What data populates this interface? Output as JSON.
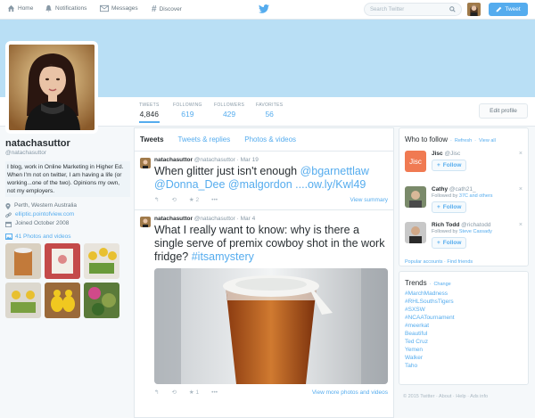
{
  "nav": {
    "home": "Home",
    "notifications": "Notifications",
    "messages": "Messages",
    "discover": "Discover",
    "search_placeholder": "Search Twitter",
    "tweet_button": "Tweet"
  },
  "stats": [
    {
      "label": "TWEETS",
      "value": "4,846"
    },
    {
      "label": "FOLLOWING",
      "value": "619"
    },
    {
      "label": "FOLLOWERS",
      "value": "429"
    },
    {
      "label": "FAVORITES",
      "value": "56"
    }
  ],
  "edit_profile": "Edit profile",
  "profile": {
    "name": "natachasuttor",
    "handle": "@natachasuttor",
    "bio": "I blog, work in Online Marketing in Higher Ed. When I'm not on twitter, I am having a life (or working...one of the two). Opinions my own, not my employers.",
    "location": "Perth, Western Australia",
    "website": "elliptic.pointofview.com",
    "joined": "Joined October 2008",
    "photos_label": "41 Photos and videos"
  },
  "tabs": [
    "Tweets",
    "Tweets & replies",
    "Photos & videos"
  ],
  "tweets": [
    {
      "name": "natachasuttor",
      "handle": "@natachasuttor",
      "date": "Mar 19",
      "text_pre": "When glitter just isn't enough ",
      "mention1": "@bgarnettlaw",
      "mention2": "@Donna_Dee",
      "mention3": "@malgordon",
      "link": "....ow.ly/Kwl49",
      "fav_count": "2",
      "action_link": "View summary"
    },
    {
      "name": "natachasuttor",
      "handle": "@natachasuttor",
      "date": "Mar 4",
      "text": "What I really want to know: why is there a single serve of premix cowboy shot in the work fridge?",
      "hashtag": "#itsamystery",
      "fav_count": "1",
      "action_link": "View more photos and videos"
    }
  ],
  "who_to_follow": {
    "title": "Who to follow",
    "refresh": "Refresh",
    "view_all": "View all",
    "follow_label": "Follow",
    "users": [
      {
        "name": "Jisc",
        "handle": "@Jisc",
        "followed_by": "",
        "followed_link": ""
      },
      {
        "name": "Cathy",
        "handle": "@cath21_",
        "followed_by": "Followed by ",
        "followed_link": "37C and others"
      },
      {
        "name": "Rich Todd",
        "handle": "@richatodd",
        "followed_by": "Followed by ",
        "followed_link": "Steve Cassady"
      }
    ],
    "footer": "Popular accounts · Find friends"
  },
  "trends": {
    "title": "Trends",
    "change": "Change",
    "items": [
      "#MarchMadness",
      "#RHLSouthsTigers",
      "#SXSW",
      "#NCAATournament",
      "#meerkat",
      "Beautiful",
      "Ted Cruz",
      "Yemen",
      "Walker",
      "Taho"
    ]
  },
  "footer": "© 2015 Twitter · About · Help · Ads info",
  "colors": {
    "accent": "#55acee",
    "cover": "#b9dff5"
  }
}
